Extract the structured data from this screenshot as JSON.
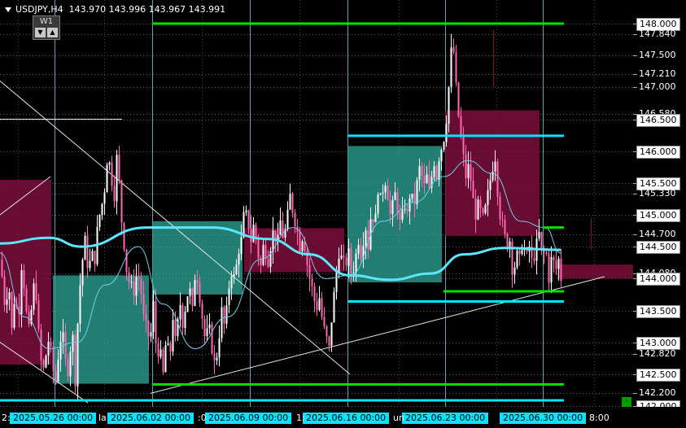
{
  "header": {
    "symbol": "USDJPY,H4",
    "ohlc": "143.970 143.996 143.967 143.991",
    "timeframe": "W1",
    "btn_down": "▼",
    "btn_up": "▲"
  },
  "price_axis": {
    "labels": [
      "148.000",
      "147.840",
      "147.500",
      "147.210",
      "147.000",
      "146.580",
      "146.500",
      "146.000",
      "145.500",
      "145.330",
      "145.000",
      "144.700",
      "144.500",
      "144.080",
      "144.000",
      "143.500",
      "143.000",
      "142.820",
      "142.500",
      "142.200",
      "142.000"
    ],
    "current": "144.000"
  },
  "time_axis": {
    "labels": [
      "2025.05.26 00:00",
      "2025.06.02 00:00",
      "2025.06.09 00:00",
      "2025.06.16 00:00",
      "2025.06.23 00:00",
      "2025.06.30 00:00"
    ],
    "fragments": [
      "2:",
      "la",
      ":0",
      "1:",
      "un",
      "8:00"
    ]
  },
  "corner_button": "-",
  "colors": {
    "bull": "#ffffff",
    "bear": "#ff69b4",
    "green_level": "#00e000",
    "cyan_level": "#00e5ff",
    "zone_teal": "#2a9d8f",
    "zone_maroon": "#7a0f3a",
    "ma_slow": "#5ee6ff",
    "ma_fast": "#6ecfe8",
    "week_sep": "#7fd9e6"
  },
  "chart_data": {
    "type": "candlestick",
    "instrument": "USDJPY",
    "timeframe": "H4",
    "ylim": [
      141.95,
      148.2
    ],
    "grid": true,
    "last_ohlc": {
      "open": 143.97,
      "high": 143.996,
      "low": 143.967,
      "close": 143.991
    },
    "weeks": [
      "2025.05.26",
      "2025.06.02",
      "2025.06.09",
      "2025.06.16",
      "2025.06.23",
      "2025.06.30"
    ],
    "close_path": [
      [
        0,
        144.3
      ],
      [
        3,
        143.9
      ],
      [
        6,
        143.5
      ],
      [
        10,
        144.0
      ],
      [
        14,
        143.2
      ],
      [
        18,
        143.8
      ],
      [
        22,
        143.3
      ],
      [
        26,
        144.2
      ],
      [
        30,
        143.8
      ],
      [
        34,
        143.1
      ],
      [
        38,
        143.5
      ],
      [
        42,
        144.0
      ],
      [
        45,
        143.6
      ],
      [
        48,
        142.9
      ],
      [
        52,
        142.5
      ],
      [
        56,
        142.8
      ],
      [
        60,
        143.1
      ],
      [
        64,
        142.6
      ],
      [
        68,
        142.4
      ],
      [
        72,
        142.9
      ],
      [
        76,
        143.2
      ],
      [
        80,
        142.7
      ],
      [
        84,
        142.5
      ],
      [
        88,
        143.3
      ],
      [
        92,
        142.4
      ],
      [
        96,
        143.6
      ],
      [
        100,
        144.2
      ],
      [
        104,
        144.6
      ],
      [
        108,
        144.1
      ],
      [
        112,
        144.4
      ],
      [
        116,
        144.3
      ],
      [
        120,
        144.9
      ],
      [
        124,
        145.1
      ],
      [
        128,
        145.4
      ],
      [
        132,
        146.0
      ],
      [
        136,
        145.6
      ],
      [
        140,
        145.3
      ],
      [
        144,
        146.1
      ],
      [
        146,
        145.5
      ],
      [
        148,
        145.0
      ],
      [
        150,
        144.8
      ],
      [
        153,
        144.4
      ],
      [
        156,
        144.0
      ],
      [
        160,
        143.9
      ],
      [
        164,
        143.8
      ],
      [
        168,
        144.1
      ],
      [
        172,
        143.9
      ],
      [
        176,
        143.4
      ],
      [
        180,
        143.2
      ],
      [
        184,
        143.0
      ],
      [
        188,
        143.6
      ],
      [
        192,
        142.8
      ],
      [
        196,
        142.9
      ],
      [
        200,
        142.5
      ],
      [
        204,
        143.1
      ],
      [
        208,
        142.7
      ],
      [
        212,
        143.4
      ],
      [
        216,
        142.9
      ],
      [
        220,
        143.7
      ],
      [
        224,
        143.3
      ],
      [
        228,
        143.6
      ],
      [
        232,
        143.9
      ],
      [
        236,
        143.5
      ],
      [
        240,
        144.2
      ],
      [
        244,
        143.8
      ],
      [
        248,
        143.4
      ],
      [
        252,
        143.0
      ],
      [
        256,
        143.3
      ],
      [
        260,
        142.9
      ],
      [
        264,
        142.6
      ],
      [
        268,
        143.0
      ],
      [
        272,
        143.5
      ],
      [
        276,
        143.2
      ],
      [
        280,
        143.8
      ],
      [
        284,
        144.1
      ],
      [
        288,
        144.0
      ],
      [
        292,
        144.4
      ],
      [
        296,
        144.6
      ],
      [
        300,
        145.1
      ],
      [
        304,
        144.9
      ],
      [
        308,
        144.6
      ],
      [
        312,
        144.9
      ],
      [
        316,
        144.4
      ],
      [
        320,
        144.2
      ],
      [
        324,
        144.6
      ],
      [
        328,
        144.2
      ],
      [
        332,
        144.5
      ],
      [
        336,
        144.8
      ],
      [
        340,
        144.5
      ],
      [
        344,
        144.9
      ],
      [
        348,
        144.6
      ],
      [
        352,
        144.9
      ],
      [
        356,
        145.3
      ],
      [
        360,
        145.0
      ],
      [
        364,
        144.8
      ],
      [
        368,
        144.5
      ],
      [
        372,
        144.7
      ],
      [
        376,
        144.3
      ],
      [
        380,
        144.0
      ],
      [
        384,
        143.8
      ],
      [
        388,
        143.5
      ],
      [
        392,
        143.7
      ],
      [
        396,
        143.3
      ],
      [
        400,
        143.1
      ],
      [
        404,
        142.9
      ],
      [
        408,
        143.5
      ],
      [
        412,
        144.0
      ],
      [
        416,
        144.4
      ],
      [
        420,
        144.3
      ],
      [
        424,
        144.2
      ],
      [
        428,
        144.4
      ],
      [
        432,
        144.0
      ],
      [
        436,
        144.3
      ],
      [
        440,
        144.6
      ],
      [
        444,
        144.3
      ],
      [
        448,
        144.9
      ],
      [
        452,
        144.5
      ],
      [
        456,
        145.1
      ],
      [
        460,
        144.8
      ],
      [
        464,
        145.4
      ],
      [
        468,
        145.2
      ],
      [
        472,
        145.6
      ],
      [
        476,
        145.3
      ],
      [
        480,
        144.9
      ],
      [
        484,
        145.4
      ],
      [
        488,
        145.1
      ],
      [
        492,
        144.8
      ],
      [
        496,
        145.2
      ],
      [
        500,
        145.0
      ],
      [
        504,
        145.4
      ],
      [
        508,
        145.1
      ],
      [
        512,
        145.5
      ],
      [
        516,
        145.8
      ],
      [
        520,
        145.4
      ],
      [
        524,
        145.6
      ],
      [
        528,
        145.3
      ],
      [
        532,
        145.9
      ],
      [
        536,
        145.6
      ],
      [
        540,
        146.0
      ],
      [
        544,
        146.1
      ],
      [
        548,
        146.5
      ],
      [
        551,
        147.0
      ],
      [
        553,
        147.5
      ],
      [
        556,
        147.7
      ],
      [
        558,
        147.4
      ],
      [
        560,
        147.0
      ],
      [
        562,
        146.6
      ],
      [
        564,
        146.5
      ],
      [
        566,
        146.2
      ],
      [
        568,
        146.0
      ],
      [
        572,
        145.6
      ],
      [
        576,
        145.8
      ],
      [
        580,
        145.3
      ],
      [
        584,
        145.0
      ],
      [
        588,
        145.2
      ],
      [
        592,
        144.9
      ],
      [
        596,
        145.1
      ],
      [
        600,
        145.4
      ],
      [
        604,
        145.7
      ],
      [
        608,
        145.9
      ],
      [
        610,
        145.5
      ],
      [
        614,
        145.0
      ],
      [
        618,
        144.8
      ],
      [
        622,
        144.5
      ],
      [
        626,
        144.6
      ],
      [
        630,
        144.0
      ],
      [
        634,
        144.4
      ],
      [
        638,
        144.3
      ],
      [
        642,
        144.6
      ],
      [
        646,
        144.3
      ],
      [
        650,
        144.5
      ],
      [
        654,
        144.2
      ],
      [
        658,
        144.5
      ],
      [
        662,
        144.7
      ],
      [
        666,
        144.3
      ],
      [
        670,
        144.5
      ],
      [
        674,
        144.0
      ],
      [
        678,
        144.4
      ],
      [
        682,
        144.1
      ],
      [
        686,
        144.3
      ],
      [
        689,
        144.0
      ]
    ],
    "ma_slow": [
      [
        0,
        144.55
      ],
      [
        60,
        144.64
      ],
      [
        100,
        144.5
      ],
      [
        180,
        144.8
      ],
      [
        260,
        144.8
      ],
      [
        330,
        144.62
      ],
      [
        380,
        144.38
      ],
      [
        430,
        144.05
      ],
      [
        480,
        143.98
      ],
      [
        530,
        144.08
      ],
      [
        570,
        144.38
      ],
      [
        620,
        144.48
      ],
      [
        689,
        144.45
      ]
    ],
    "ma_fast": [
      [
        0,
        144.4
      ],
      [
        30,
        143.4
      ],
      [
        60,
        142.9
      ],
      [
        95,
        143.0
      ],
      [
        130,
        143.9
      ],
      [
        170,
        144.5
      ],
      [
        200,
        143.6
      ],
      [
        240,
        142.9
      ],
      [
        280,
        143.4
      ],
      [
        320,
        144.3
      ],
      [
        360,
        144.8
      ],
      [
        400,
        144.0
      ],
      [
        430,
        144.05
      ],
      [
        470,
        144.9
      ],
      [
        510,
        145.2
      ],
      [
        545,
        145.6
      ],
      [
        575,
        145.85
      ],
      [
        605,
        145.65
      ],
      [
        640,
        144.9
      ],
      [
        670,
        144.8
      ],
      [
        689,
        144.4
      ]
    ],
    "zones": [
      {
        "x0": 0,
        "x1": 63,
        "top": 145.55,
        "bottom": 142.65,
        "color": "maroon"
      },
      {
        "x0": 65,
        "x1": 183,
        "top": 144.05,
        "bottom": 142.35,
        "color": "teal"
      },
      {
        "x0": 187,
        "x1": 298,
        "top": 144.9,
        "bottom": 143.75,
        "color": "teal"
      },
      {
        "x0": 300,
        "x1": 423,
        "top": 144.79,
        "bottom": 144.1,
        "color": "maroon"
      },
      {
        "x0": 427,
        "x1": 543,
        "top": 146.08,
        "bottom": 143.94,
        "color": "teal"
      },
      {
        "x0": 547,
        "x1": 663,
        "top": 146.64,
        "bottom": 144.67,
        "color": "maroon"
      },
      {
        "x0": 685,
        "x1": 778,
        "top": 144.22,
        "bottom": 144.0,
        "color": "maroon"
      }
    ],
    "levels": [
      {
        "x0": 187,
        "x1": 693,
        "price": 148.0,
        "color": "green"
      },
      {
        "x0": 187,
        "x1": 693,
        "price": 142.34,
        "color": "green"
      },
      {
        "x0": 0,
        "x1": 693,
        "price": 142.09,
        "color": "cyan"
      },
      {
        "x0": 427,
        "x1": 693,
        "price": 146.24,
        "color": "cyan"
      },
      {
        "x0": 427,
        "x1": 693,
        "price": 143.64,
        "color": "cyan"
      },
      {
        "x0": 545,
        "x1": 693,
        "price": 143.8,
        "color": "green"
      },
      {
        "x0": 667,
        "x1": 693,
        "price": 144.8,
        "color": "green"
      }
    ],
    "trendlines": [
      {
        "x0": 185,
        "y0": 142.2,
        "x1": 743,
        "y1": 144.03
      },
      {
        "x0": 0,
        "y0": 143.0,
        "x1": 108,
        "y1": 142.05
      },
      {
        "x0": 0,
        "y0": 147.1,
        "x1": 430,
        "y1": 142.5
      },
      {
        "x0": 0,
        "y0": 145.0,
        "x1": 62,
        "y1": 145.6
      },
      {
        "x0": 0,
        "y0": 146.5,
        "x1": 150,
        "y1": 146.5
      }
    ]
  }
}
